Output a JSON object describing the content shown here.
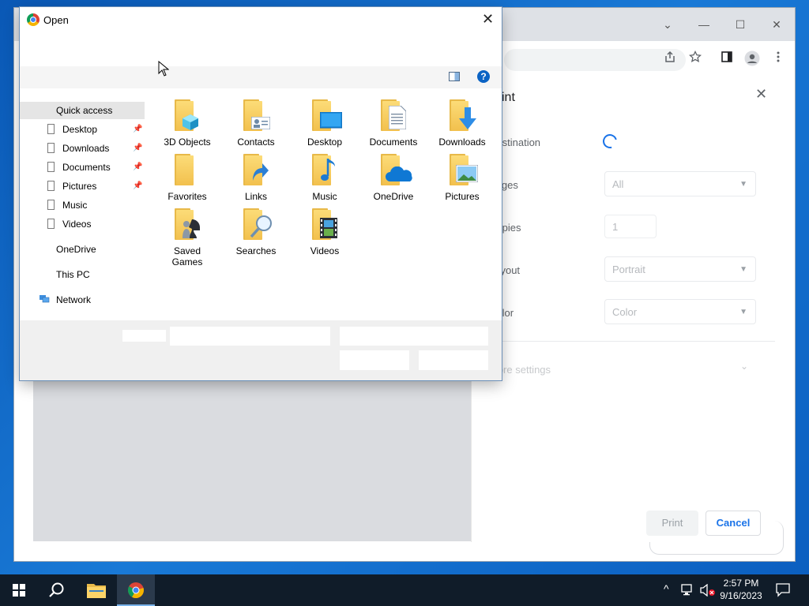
{
  "chrome": {
    "window_controls": {
      "collapse": "⌄",
      "minimize": "—",
      "maximize": "☐",
      "close": "✕"
    },
    "toolbar_icons": [
      "share-icon",
      "star-icon",
      "side-panel-icon",
      "profile-icon",
      "kebab-menu-icon"
    ]
  },
  "print_panel": {
    "title": "Print",
    "destination_label": "Destination",
    "pages_label": "Pages",
    "pages_value": "All",
    "copies_label": "Copies",
    "copies_value": "1",
    "layout_label": "Layout",
    "layout_value": "Portrait",
    "color_label": "Color",
    "color_value": "Color",
    "more_settings": "More settings",
    "print_button": "Print",
    "cancel_button": "Cancel"
  },
  "dialog": {
    "title": "Open",
    "close": "✕",
    "help": "?",
    "nav": {
      "quick_access": "Quick access",
      "items": [
        {
          "label": "Desktop",
          "pinned": true
        },
        {
          "label": "Downloads",
          "pinned": true
        },
        {
          "label": "Documents",
          "pinned": true
        },
        {
          "label": "Pictures",
          "pinned": true
        },
        {
          "label": "Music",
          "pinned": false
        },
        {
          "label": "Videos",
          "pinned": false
        }
      ],
      "onedrive": "OneDrive",
      "this_pc": "This PC",
      "network": "Network"
    },
    "folders": [
      {
        "label": "3D Objects",
        "icon": "3d-objects-folder-icon"
      },
      {
        "label": "Contacts",
        "icon": "contacts-folder-icon"
      },
      {
        "label": "Desktop",
        "icon": "desktop-folder-icon"
      },
      {
        "label": "Documents",
        "icon": "documents-folder-icon"
      },
      {
        "label": "Downloads",
        "icon": "downloads-folder-icon"
      },
      {
        "label": "Favorites",
        "icon": "favorites-folder-icon"
      },
      {
        "label": "Links",
        "icon": "links-folder-icon"
      },
      {
        "label": "Music",
        "icon": "music-folder-icon"
      },
      {
        "label": "OneDrive",
        "icon": "onedrive-folder-icon"
      },
      {
        "label": "Pictures",
        "icon": "pictures-folder-icon"
      },
      {
        "label": "Saved Games",
        "icon": "saved-games-folder-icon"
      },
      {
        "label": "Searches",
        "icon": "searches-folder-icon"
      },
      {
        "label": "Videos",
        "icon": "videos-folder-icon"
      }
    ]
  },
  "taskbar": {
    "time": "2:57 PM",
    "date": "9/16/2023",
    "tray_chevron": "^"
  },
  "colors": {
    "accent": "#1a73e8",
    "desktop": "#1979d6",
    "taskbar": "#101c29",
    "folder": "#f2c04d"
  }
}
